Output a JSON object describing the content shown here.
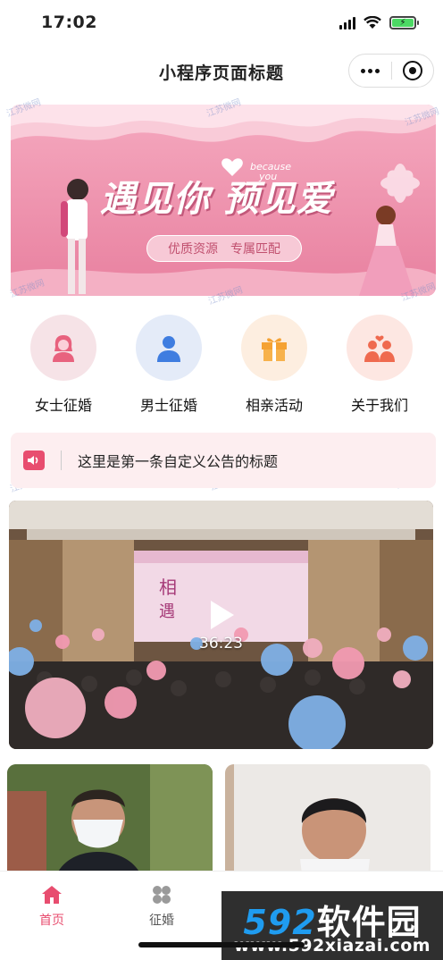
{
  "status_bar": {
    "time": "17:02"
  },
  "nav_bar": {
    "title": "小程序页面标题"
  },
  "banner": {
    "title": "遇见你 预见爱",
    "badge_line1": "because",
    "badge_line2": "you",
    "tag1": "优质资源",
    "tag2": "专属匹配"
  },
  "watermark_text": "江苏微网",
  "categories": [
    {
      "label": "女士征婚",
      "color": "#f6e3e7",
      "icon": "female-user-icon"
    },
    {
      "label": "男士征婚",
      "color": "#e4ebf8",
      "icon": "male-user-icon"
    },
    {
      "label": "相亲活动",
      "color": "#fdeee0",
      "icon": "gift-icon"
    },
    {
      "label": "关于我们",
      "color": "#fde7e2",
      "icon": "couple-icon"
    }
  ],
  "notice": {
    "text": "这里是第一条自定义公告的标题"
  },
  "video": {
    "duration": "36:23",
    "screen_text_1": "相",
    "screen_text_2": "遇"
  },
  "tabs": [
    {
      "label": "首页",
      "active": true,
      "color": "#e84d6f"
    },
    {
      "label": "征婚",
      "active": false,
      "color": "#666666"
    }
  ],
  "promo": {
    "numbers": "592",
    "name": "软件园",
    "url": "www.592xiazai.com"
  },
  "colors": {
    "accent": "#e84d6f",
    "banner": "#eb8ba8"
  }
}
